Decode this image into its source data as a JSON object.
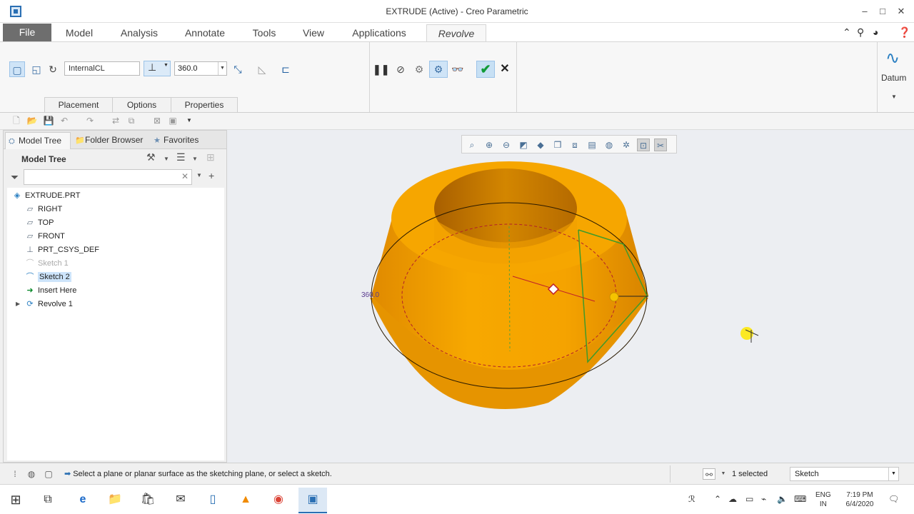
{
  "window": {
    "title": "EXTRUDE (Active) - Creo Parametric"
  },
  "ribbon_tabs": [
    "File",
    "Model",
    "Analysis",
    "Annotate",
    "Tools",
    "View",
    "Applications",
    "Revolve"
  ],
  "revolve": {
    "axis_value": "InternalCL",
    "angle_value": "360.0",
    "subtabs": [
      "Placement",
      "Options",
      "Properties"
    ],
    "datum_label": "Datum"
  },
  "nav_tabs": [
    "Model Tree",
    "Folder Browser",
    "Favorites"
  ],
  "model_tree": {
    "header": "Model Tree",
    "filter_placeholder": "",
    "items": [
      {
        "label": "EXTRUDE.PRT",
        "icon": "part-icon"
      },
      {
        "label": "RIGHT",
        "icon": "datum-plane-icon"
      },
      {
        "label": "TOP",
        "icon": "datum-plane-icon"
      },
      {
        "label": "FRONT",
        "icon": "datum-plane-icon"
      },
      {
        "label": "PRT_CSYS_DEF",
        "icon": "csys-icon"
      },
      {
        "label": "Sketch 1",
        "icon": "sketch-icon"
      },
      {
        "label": "Sketch 2",
        "icon": "sketch-icon"
      },
      {
        "label": "Insert Here",
        "icon": "insert-arrow-icon"
      },
      {
        "label": "Revolve 1",
        "icon": "revolve-icon"
      }
    ]
  },
  "graphics": {
    "dimension_label": "360.0"
  },
  "status": {
    "message": "Select a plane or planar surface as the sketching plane, or select a sketch.",
    "selected": "1 selected",
    "filter": "Sketch"
  },
  "taskbar": {
    "lang": "ENG",
    "region": "IN",
    "time": "7:19 PM",
    "date": "6/4/2020"
  },
  "colors": {
    "model_orange": "#f59e0b",
    "accent_blue": "#2a6fb3",
    "ok_green": "#119b38"
  }
}
